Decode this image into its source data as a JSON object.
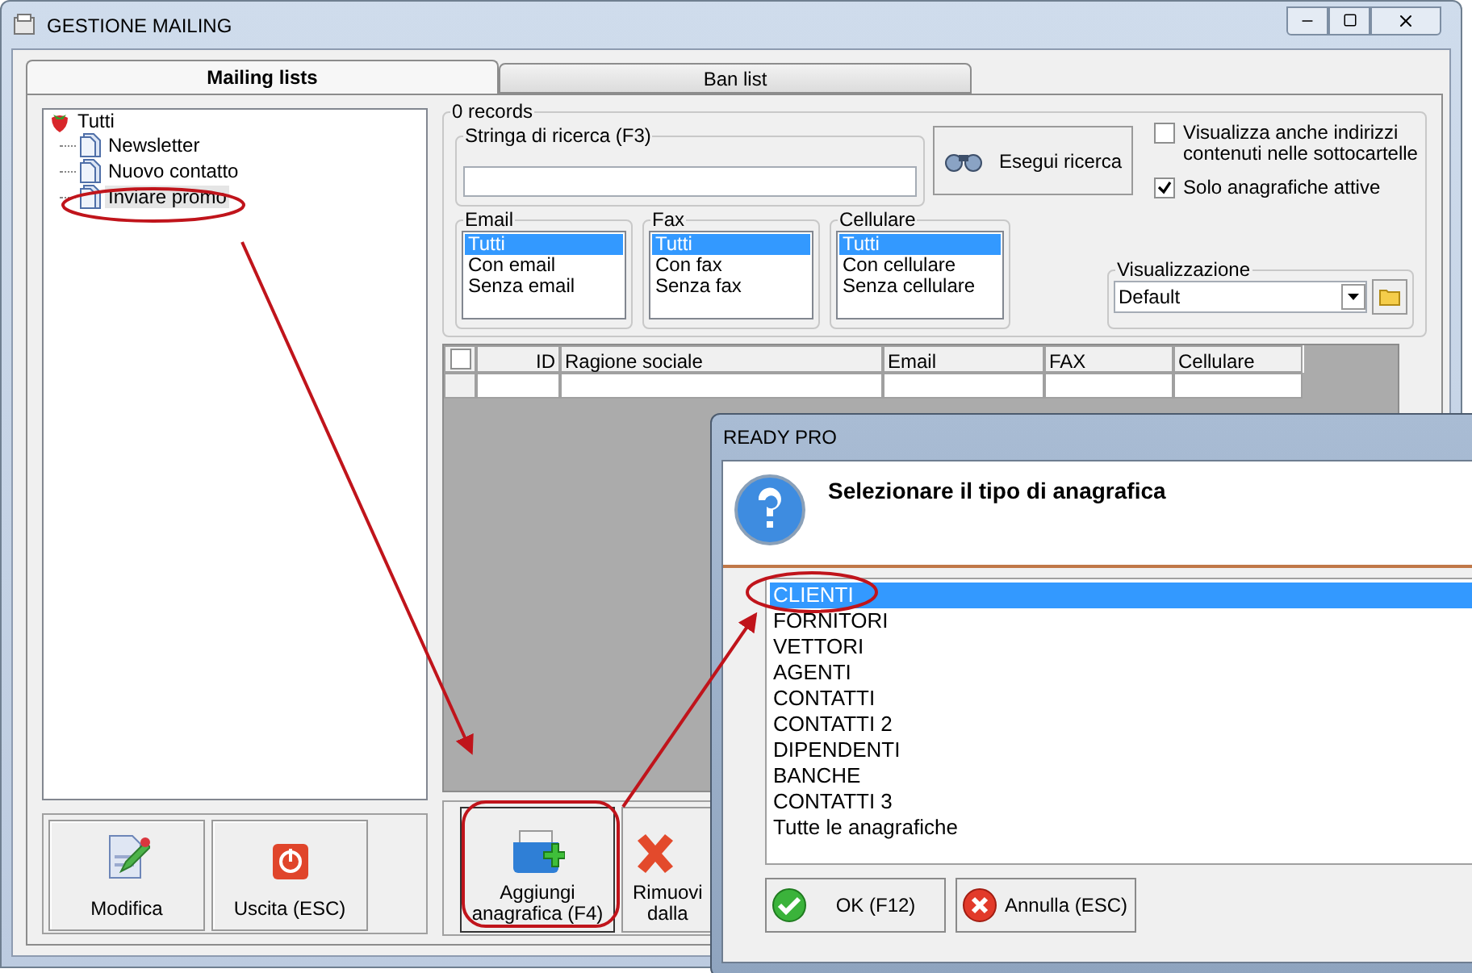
{
  "window": {
    "title": "GESTIONE MAILING"
  },
  "tabs": [
    {
      "label": "Mailing lists",
      "selected": true
    },
    {
      "label": "Ban list",
      "selected": false
    }
  ],
  "tree": {
    "label": "Tutti",
    "children": [
      {
        "label": "Newsletter",
        "selected": false
      },
      {
        "label": "Nuovo contatto",
        "selected": false
      },
      {
        "label": "Inviare promo",
        "selected": true
      }
    ]
  },
  "left_buttons": [
    {
      "kind": "edit",
      "label": "Modifica"
    },
    {
      "kind": "exit",
      "label": "Uscita (ESC)"
    }
  ],
  "search": {
    "records": "0 records",
    "field_label": "Stringa di ricerca (F3)",
    "button": "Esegui ricerca"
  },
  "options": [
    {
      "label": "Visualizza anche indirizzi contenuti nelle sottocartelle",
      "checked": false
    },
    {
      "label": "Solo anagrafiche attive",
      "checked": true
    }
  ],
  "filters": [
    {
      "title": "Email",
      "items": [
        {
          "label": "Tutti",
          "selected": true
        },
        {
          "label": "Con email",
          "selected": false
        },
        {
          "label": "Senza email",
          "selected": false
        }
      ]
    },
    {
      "title": "Fax",
      "items": [
        {
          "label": "Tutti",
          "selected": true
        },
        {
          "label": "Con fax",
          "selected": false
        },
        {
          "label": "Senza fax",
          "selected": false
        }
      ]
    },
    {
      "title": "Cellulare",
      "items": [
        {
          "label": "Tutti",
          "selected": true
        },
        {
          "label": "Con cellulare",
          "selected": false
        },
        {
          "label": "Senza cellulare",
          "selected": false
        }
      ]
    }
  ],
  "view": {
    "label": "Visualizzazione",
    "value": "Default"
  },
  "table": {
    "select_all_checked": false,
    "columns": [
      "ID",
      "Ragione sociale",
      "Email",
      "FAX",
      "Cellulare"
    ]
  },
  "bottom_buttons": [
    {
      "kind": "add",
      "lines": [
        "Aggiungi",
        "anagrafica (F4)"
      ]
    },
    {
      "kind": "remove",
      "lines": [
        "Rimuovi",
        "dalla"
      ]
    }
  ],
  "dialog": {
    "title": "READY PRO",
    "message": "Selezionare il tipo di anagrafica",
    "options": [
      {
        "label": "CLIENTI",
        "selected": true
      },
      {
        "label": "FORNITORI",
        "selected": false
      },
      {
        "label": "VETTORI",
        "selected": false
      },
      {
        "label": "AGENTI",
        "selected": false
      },
      {
        "label": "CONTATTI",
        "selected": false
      },
      {
        "label": "CONTATTI 2",
        "selected": false
      },
      {
        "label": "DIPENDENTI",
        "selected": false
      },
      {
        "label": "BANCHE",
        "selected": false
      },
      {
        "label": "CONTATTI 3",
        "selected": false
      },
      {
        "label": "Tutte le anagrafiche",
        "selected": false
      }
    ],
    "buttons": [
      {
        "kind": "ok",
        "label": "OK (F12)"
      },
      {
        "kind": "cancel",
        "label": "Annulla (ESC)"
      }
    ]
  }
}
